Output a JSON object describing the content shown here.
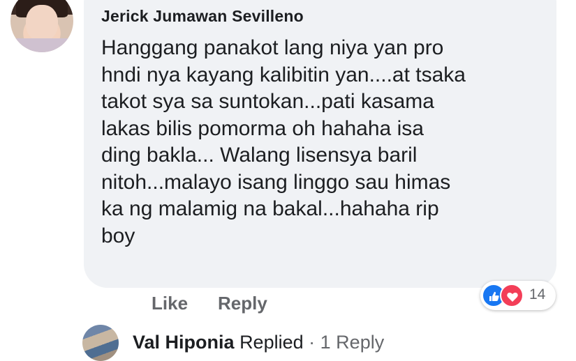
{
  "comment": {
    "author": "Jerick Jumawan Sevilleno",
    "lines": [
      "Hanggang panakot lang niya yan pro",
      "hndi nya kayang kalibitin yan....at tsaka",
      "takot sya sa suntokan...pati kasama",
      "lakas bilis pomorma oh hahaha isa",
      "ding bakla... Walang lisensya baril",
      "nitoh...malayo isang linggo sau himas",
      "ka ng malamig na bakal...hahaha rip",
      "boy"
    ],
    "reactions": {
      "icons": [
        "like-icon",
        "love-icon"
      ],
      "count": "14",
      "colors": {
        "like": "#1877f2",
        "love": "#f33e58"
      }
    }
  },
  "actions": {
    "like_label": "Like",
    "reply_label": "Reply"
  },
  "reply_summary": {
    "name": "Val Hiponia",
    "verb": "Replied",
    "separator": "·",
    "count_label": "1 Reply"
  },
  "colors": {
    "bubble": "#f0f2f5",
    "text": "#1c1e21",
    "muted": "#65676b"
  }
}
